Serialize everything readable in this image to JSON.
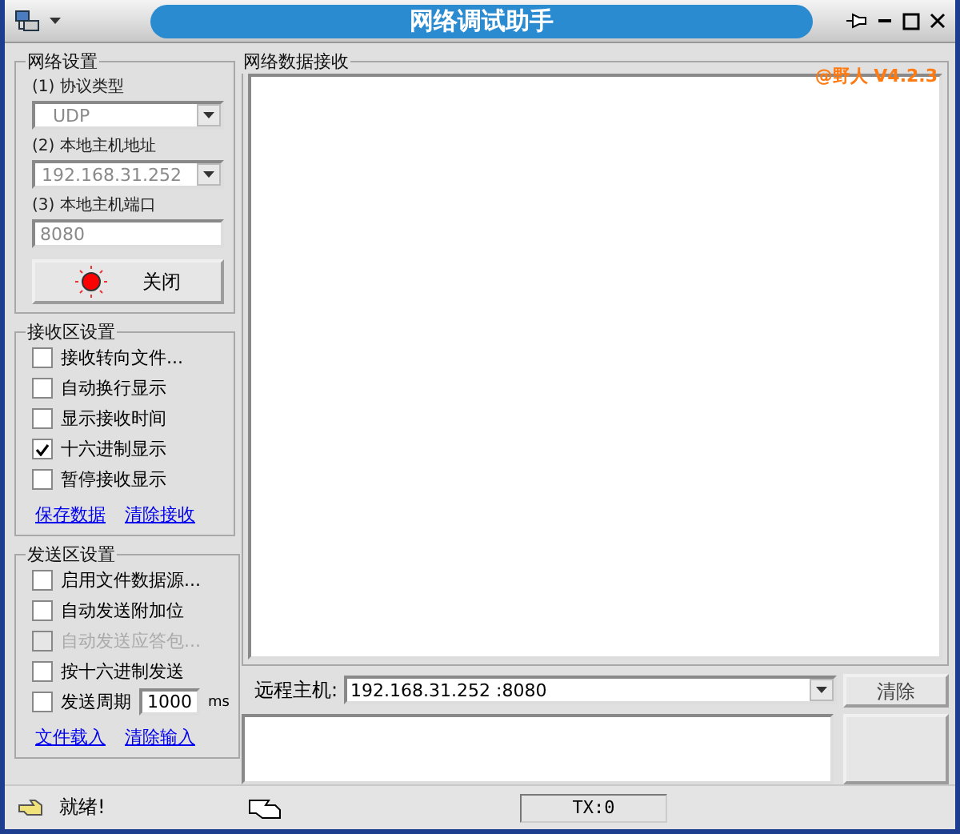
{
  "window": {
    "title": "网络调试助手"
  },
  "network_settings": {
    "title": "网络设置",
    "fields_disabled": true,
    "protocol_label": "(1) 协议类型",
    "protocol": "UDP",
    "host_label": "(2) 本地主机地址",
    "host": "192.168.31.252",
    "port_label": "(3) 本地主机端口",
    "port": "8080",
    "connect_button": {
      "label": "关闭",
      "connected": true
    }
  },
  "receive_settings": {
    "title": "接收区设置",
    "options": [
      {
        "label": "接收转向文件...",
        "checked": false
      },
      {
        "label": "自动换行显示",
        "checked": false
      },
      {
        "label": "显示接收时间",
        "checked": false
      },
      {
        "label": "十六进制显示",
        "checked": true
      },
      {
        "label": "暂停接收显示",
        "checked": false
      }
    ],
    "links": [
      "保存数据",
      "清除接收"
    ]
  },
  "send_settings": {
    "title": "发送区设置",
    "options": [
      {
        "kind": "check",
        "label": "启用文件数据源...",
        "checked": false,
        "disabled": false
      },
      {
        "kind": "check",
        "label": "自动发送附加位",
        "checked": false,
        "disabled": false
      },
      {
        "kind": "check",
        "label": "自动发送应答包...",
        "checked": false,
        "disabled": true
      },
      {
        "kind": "check",
        "label": "按十六进制发送",
        "checked": false,
        "disabled": false
      },
      {
        "kind": "period",
        "label": "发送周期",
        "checked": false,
        "disabled": false,
        "value": "1000",
        "unit": "ms"
      }
    ],
    "links": [
      "文件载入",
      "清除输入"
    ]
  },
  "receive_area": {
    "title": "网络数据接收",
    "version": "@野人  V4.2.3"
  },
  "remote": {
    "label": "远程主机:",
    "value": "192.168.31.252  :8080",
    "clear_button": "清除"
  },
  "status_bar": {
    "message": "就绪!",
    "tx": "TX:0"
  }
}
